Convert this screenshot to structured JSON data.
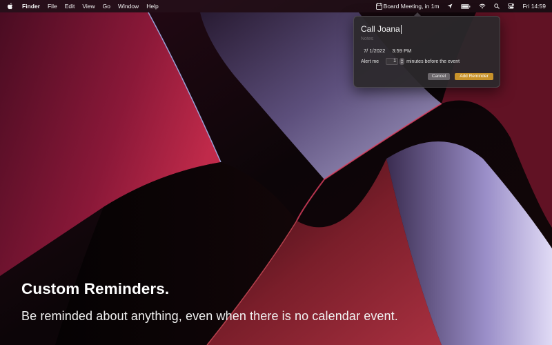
{
  "menubar": {
    "items": [
      "Finder",
      "File",
      "Edit",
      "View",
      "Go",
      "Window",
      "Help"
    ],
    "status": {
      "event_label": "Board Meeting, in 1m",
      "clock": "Fri 14:59"
    }
  },
  "popover": {
    "title_value": "Call Joana",
    "notes_placeholder": "Notes",
    "date": "7/  1/2022",
    "time": "3:59 PM",
    "alert_prefix": "Alert me",
    "alert_minutes": "1",
    "alert_suffix": "minutes before the event",
    "cancel_label": "Cancel",
    "add_label": "Add Reminder"
  },
  "caption": {
    "headline": "Custom Reminders.",
    "subheadline": "Be reminded about anything, even when there is no calendar event."
  },
  "colors": {
    "accent": "#c8922a",
    "menubar_bg": "#28141e"
  },
  "icons": [
    "apple-icon",
    "calendar-icon",
    "location-arrow-icon",
    "battery-icon",
    "wifi-icon",
    "search-icon",
    "control-center-icon"
  ]
}
